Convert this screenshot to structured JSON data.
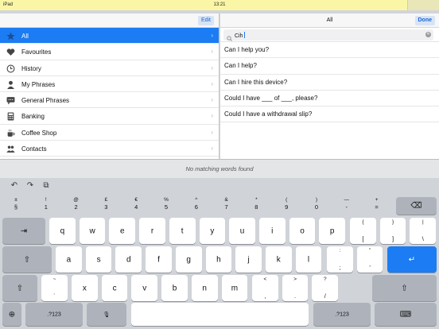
{
  "statusbar": {
    "carrier": "iPad",
    "time": "13:21"
  },
  "left": {
    "edit_label": "Edit",
    "categories": [
      {
        "label": "All",
        "icon": "star-icon",
        "selected": true
      },
      {
        "label": "Favourites",
        "icon": "heart-icon"
      },
      {
        "label": "History",
        "icon": "clock-icon"
      },
      {
        "label": "My Phrases",
        "icon": "person-icon"
      },
      {
        "label": "General Phrases",
        "icon": "speech-bubble-icon"
      },
      {
        "label": "Banking",
        "icon": "calculator-icon"
      },
      {
        "label": "Coffee Shop",
        "icon": "coffee-cup-icon"
      },
      {
        "label": "Contacts",
        "icon": "people-icon"
      }
    ]
  },
  "right": {
    "title": "All",
    "done_label": "Done",
    "search_value": "Cih",
    "phrases": [
      "Can I help you?",
      "Can I help?",
      "Can I hire this device?",
      "Could I have ___ of ___, please?",
      "Could I have a withdrawal slip?"
    ]
  },
  "suggestion": "No matching words found",
  "keyboard": {
    "tools": [
      "↶",
      "↷",
      "⧉"
    ],
    "number_row": [
      [
        "±",
        "§"
      ],
      [
        "!",
        "1"
      ],
      [
        "@",
        "2"
      ],
      [
        "£",
        "3"
      ],
      [
        "€",
        "4"
      ],
      [
        "%",
        "5"
      ],
      [
        "^",
        "6"
      ],
      [
        "&",
        "7"
      ],
      [
        "*",
        "8"
      ],
      [
        "(",
        "9"
      ],
      [
        ")",
        "0"
      ],
      [
        "—",
        "-"
      ],
      [
        "+",
        "="
      ]
    ],
    "delete": "⌫",
    "row_q": [
      "q",
      "w",
      "e",
      "r",
      "t",
      "y",
      "u",
      "i",
      "o",
      "p"
    ],
    "row_q_extra": [
      [
        "{",
        "["
      ],
      [
        "}",
        "]"
      ],
      [
        "|",
        "\\"
      ]
    ],
    "tab": "⇥",
    "row_a": [
      "a",
      "s",
      "d",
      "f",
      "g",
      "h",
      "j",
      "k",
      "l"
    ],
    "row_a_extra": [
      [
        ":",
        ";"
      ],
      [
        "”",
        "’"
      ]
    ],
    "shift": "⇧",
    "return": "↵",
    "row_z_lead": [
      [
        "~",
        "`"
      ]
    ],
    "row_z": [
      "x",
      "c",
      "v",
      "b",
      "n",
      "m"
    ],
    "row_z_extra": [
      [
        "<",
        ","
      ],
      [
        ">",
        "."
      ],
      [
        "?",
        "/"
      ]
    ],
    "globe": "⊕",
    "numbers_label": ".?123",
    "mic": "🎙",
    "keyboard_hide": "⌨"
  }
}
